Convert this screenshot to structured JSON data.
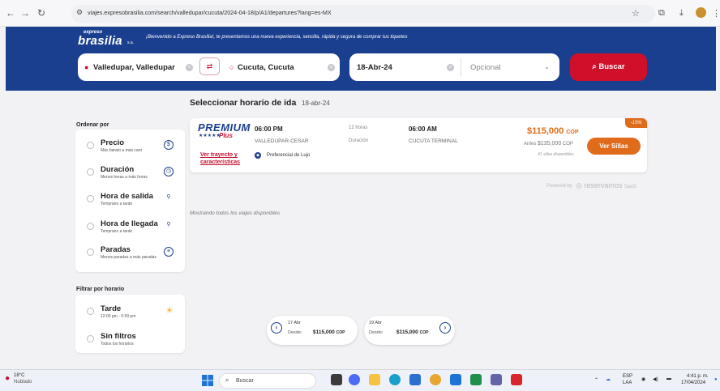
{
  "browser": {
    "url": "viajes.expresobrasilia.com/search/valledupar/cucuta/2024-04-18/p/A1/departures?lang=es-MX",
    "icons": [
      "back-icon",
      "forward-icon",
      "reload-icon",
      "site-info-icon",
      "star-icon",
      "extensions-icon",
      "download-icon",
      "profile-icon",
      "menu-icon"
    ]
  },
  "header": {
    "logo_top": "expreso",
    "logo_main": "brasilia",
    "logo_suffix": "s.a.",
    "welcome": "¡Bienvenido a Expreso Brasilia!, te presentamos una nueva experiencia, sencilla, rápida y segura de comprar tus tiquetes",
    "origin": "Valledupar, Valledupar",
    "destination": "Cucuta, Cucuta",
    "date": "18-Abr-24",
    "return_placeholder": "Opcional",
    "search_button": "Buscar",
    "accent": "#d0102b",
    "brand": "#1b3f8f"
  },
  "main": {
    "title": "Seleccionar horario de ida",
    "title_date": "18-abr-24",
    "showing": "Mostrando todos los viajes disponibles",
    "powered_prefix": "Powered by",
    "powered_brand": "reservamos",
    "powered_suffix": "SaaS"
  },
  "sort": {
    "heading": "Ordenar por",
    "items": [
      {
        "label": "Precio",
        "sub": "Más barato a más caro",
        "icon": "dollar-icon",
        "glyph": "$"
      },
      {
        "label": "Duración",
        "sub": "Menos horas a más horas",
        "icon": "clock-icon",
        "glyph": "◷"
      },
      {
        "label": "Hora de salida",
        "sub": "Temprano a tarde",
        "icon": "departure-icon",
        "glyph": "⚲"
      },
      {
        "label": "Hora de llegada",
        "sub": "Temprano a tarde",
        "icon": "arrival-icon",
        "glyph": "⚲"
      },
      {
        "label": "Paradas",
        "sub": "Menos paradas a más paradas",
        "icon": "stops-icon",
        "glyph": "≡"
      }
    ]
  },
  "filter": {
    "heading": "Filtrar por horario",
    "items": [
      {
        "label": "Tarde",
        "sub": "12:00 pm - 6:59 pm",
        "icon": "sun-icon"
      },
      {
        "label": "Sin filtros",
        "sub": "Todos los horarios"
      }
    ]
  },
  "trip": {
    "brand": "PREMIUM",
    "stars": "★★★★★",
    "plus": "Plus",
    "route_link": "Ver trayecto y características",
    "departure_time": "06:00 PM",
    "departure_city": "VALLEDUPAR-CESAR",
    "service_class": "Preferencial de Lujo",
    "duration_value": "12 horas",
    "duration_label": "Duración",
    "arrival_time": "06:00 AM",
    "arrival_city": "CUCUTA TERMINAL",
    "discount": "-15%",
    "price": "$115,000",
    "currency": "COP",
    "old_price_prefix": "Antes",
    "old_price": "$135,000",
    "old_currency": "COP",
    "seats": "41 sillas disponibles",
    "seats_button": "Ver Sillas",
    "price_color": "#e06b1b"
  },
  "date_nav": {
    "prev": {
      "date": "17 Abr",
      "desde": "Desde:",
      "price": "$115,000",
      "currency": "COP"
    },
    "next": {
      "date": "19 Abr",
      "desde": "Desde:",
      "price": "$115,000",
      "currency": "COP"
    }
  },
  "taskbar": {
    "weather_temp": "18°C",
    "weather_desc": "Nublado",
    "search_placeholder": "Buscar",
    "lang": "ESP",
    "lang_sub": "LAA",
    "time": "4:41 p. m.",
    "date": "17/04/2024"
  }
}
